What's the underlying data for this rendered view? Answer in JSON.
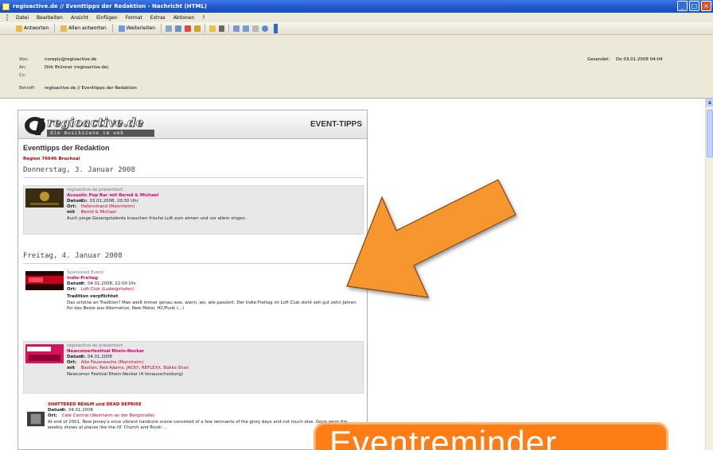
{
  "window": {
    "title": "regioactive.de // Eventtipps der Redaktion - Nachricht (HTML)",
    "buttons": [
      "_",
      "□",
      "×"
    ]
  },
  "menubar": {
    "items": [
      "Datei",
      "Bearbeiten",
      "Ansicht",
      "Einfügen",
      "Format",
      "Extras",
      "Aktionen",
      "?"
    ]
  },
  "toolbar": {
    "reply": "Antworten",
    "reply_all": "Allen antworten",
    "forward": "Weiterleiten"
  },
  "header": {
    "from_label": "Von:",
    "from_value": "noreply@regioactive.de",
    "to_label": "An:",
    "to_value": "Dirk Brünner (regioactive.de)",
    "cc_label": "Cc:",
    "cc_value": "",
    "subject_label": "Betreff:",
    "subject_value": "regioactive.de // Eventtipps der Redaktion",
    "sent_label": "Gesendet:",
    "sent_value": "Do 03.01.2008 04:04"
  },
  "newsletter": {
    "logo_word": "regioactive.de",
    "logo_sub": "die musikszene im web",
    "event_tipps": "EVENT-TIPPS",
    "title": "Eventtipps der Redaktion",
    "region": "Region 76646 Bruchsal",
    "days": [
      {
        "label": "Donnerstag, 3. Januar 2008",
        "events": [
          {
            "pre": "regioactive.de präsentiert:",
            "title": "Acoustic Pop Bar mit Bernd & Michael",
            "date_label": "Datum:",
            "date_value": "Do, 03.01.2008, 20:30 Uhr",
            "place_label": "Ort:",
            "place_value": "Hafenstrand (Mannheim)",
            "with_label": "mit",
            "with_value": "Bernd & Michael",
            "desc": "Auch junge Gesangstalente brauchen frische Luft zum atmen und vor allem singen."
          }
        ]
      },
      {
        "label": "Freitag, 4. Januar 2008",
        "events": [
          {
            "pre": "Sponsored Event:",
            "title": "Indie-Freitag",
            "date_label": "Datum:",
            "date_value": "Fr, 04.01.2008, 22:00 Uhr",
            "place_label": "Ort:",
            "place_value": "Loft Club (Ludwigshafen)",
            "tradition": "Tradition verpflichtet",
            "desc": "Das schöne an Tradition? Man weiß immer genau was, wann, wo, wie passiert. Der Indie-Freitag im Loft Club steht seit gut zehn Jahren für das Beste aus Alternative, New Metal, HC/Punk (...)"
          },
          {
            "pre": "regioactive.de präsentiert:",
            "title": "Newcomerfestival Rhein-Neckar",
            "date_label": "Datum:",
            "date_value": "Fr, 04.01.2008",
            "place_label": "Ort:",
            "place_value": "Alte Feuerwache (Mannheim)",
            "with_label": "mit",
            "with_value": "Bastian, Red Adams, JACKY, REFLEXX, Bakko Shan",
            "desc": "Newcomer Festival Rhein-Neckar (4.Vorausscheidung)"
          },
          {
            "pre": "",
            "title": "SHATTERED REALM und DEAD REPRISE",
            "date_label": "Datum:",
            "date_value": "Fr, 04.01.2008",
            "place_label": "Ort:",
            "place_value": "Café Central (Weinheim an der Bergstraße)",
            "desc": "At end of 2001, New Jersey's once vibrant hardcore scene consisted of a few remnants of the glory days and not much else. Gone were the weekly shows at places like the Ol' Church and Rivoli ..."
          }
        ]
      }
    ]
  },
  "caption": {
    "text": "Eventreminder"
  },
  "colors": {
    "arrow_fill": "#f7952e",
    "caption_fill": "#ff7d14",
    "accent_pink": "#e0006a"
  }
}
